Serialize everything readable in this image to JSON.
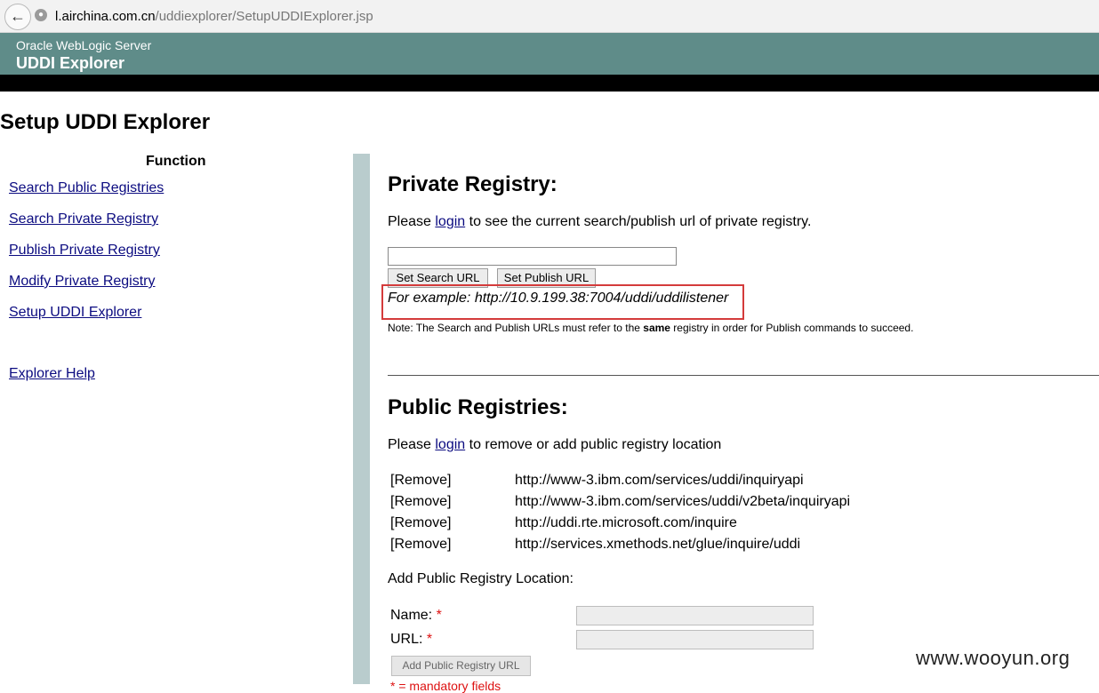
{
  "browser": {
    "url_host": "l.airchina.com.cn",
    "url_path": "/uddiexplorer/SetupUDDIExplorer.jsp"
  },
  "banner": {
    "product": "Oracle WebLogic Server",
    "app": "UDDI Explorer"
  },
  "page_title": "Setup UDDI Explorer",
  "nav": {
    "heading": "Function",
    "items": [
      "Search Public Registries",
      "Search Private Registry",
      "Publish Private Registry",
      "Modify Private Registry",
      "Setup UDDI Explorer"
    ],
    "help": "Explorer Help"
  },
  "private": {
    "title": "Private Registry:",
    "text_before": "Please ",
    "login": "login",
    "text_after": " to see the current search/publish url of private registry.",
    "url_value": "",
    "set_search_label": "Set Search URL",
    "set_publish_label": "Set Publish URL",
    "example": "For example: http://10.9.199.38:7004/uddi/uddilistener",
    "note_before": "Note: The Search and Publish URLs must refer to the ",
    "note_bold": "same",
    "note_after": " registry in order for Publish commands to succeed."
  },
  "public": {
    "title": "Public Registries:",
    "text_before": "Please ",
    "login": "login",
    "text_after": " to remove or add public registry location",
    "registries": [
      {
        "remove": "[Remove]",
        "url": "http://www-3.ibm.com/services/uddi/inquiryapi"
      },
      {
        "remove": "[Remove]",
        "url": "http://www-3.ibm.com/services/uddi/v2beta/inquiryapi"
      },
      {
        "remove": "[Remove]",
        "url": "http://uddi.rte.microsoft.com/inquire"
      },
      {
        "remove": "[Remove]",
        "url": "http://services.xmethods.net/glue/inquire/uddi"
      }
    ],
    "add_label": "Add Public Registry Location:",
    "name_label": "Name: ",
    "url_label": "URL: ",
    "required_mark": "*",
    "add_button": "Add Public Registry URL",
    "required_note": "* = mandatory fields"
  },
  "watermark": "www.wooyun.org"
}
